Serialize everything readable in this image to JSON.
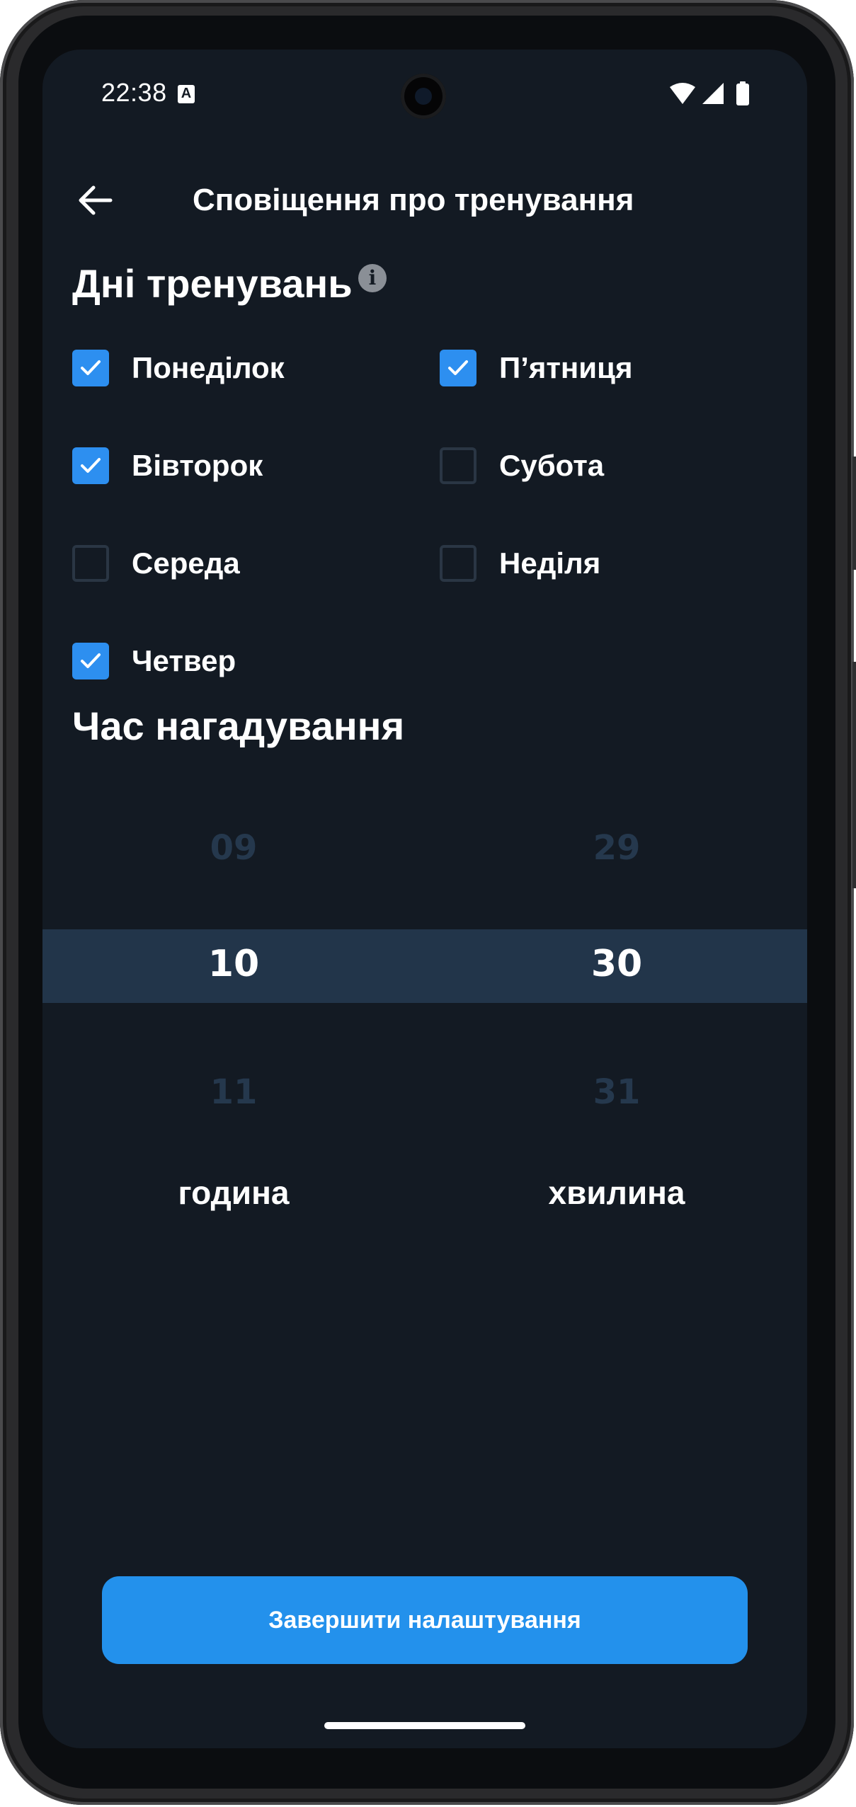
{
  "status_bar": {
    "time": "22:38",
    "notification_icon": "a-text-icon",
    "notification_letter": "A",
    "icons": [
      "wifi-icon",
      "signal-icon",
      "battery-icon"
    ]
  },
  "header": {
    "back_icon": "back-arrow-icon",
    "title": "Сповіщення про тренування"
  },
  "training_days": {
    "title": "Дні тренувань",
    "info_icon": "info-icon",
    "info_glyph": "i",
    "days": [
      {
        "label": "Понеділок",
        "checked": true
      },
      {
        "label": "Вівторок",
        "checked": true
      },
      {
        "label": "Середа",
        "checked": false
      },
      {
        "label": "Четвер",
        "checked": true
      },
      {
        "label": "П’ятниця",
        "checked": true
      },
      {
        "label": "Субота",
        "checked": false
      },
      {
        "label": "Неділя",
        "checked": false
      }
    ]
  },
  "reminder_time": {
    "title": "Час нагадування",
    "hour": {
      "prev": "09",
      "selected": "10",
      "next": "11",
      "unit": "година"
    },
    "minute": {
      "prev": "29",
      "selected": "30",
      "next": "31",
      "unit": "хвилина"
    }
  },
  "footer": {
    "finish_button": "Завершити налаштування"
  },
  "colors": {
    "background": "#131a23",
    "accent": "#2391ec",
    "checkbox_checked": "#2d8ff0",
    "picker_highlight": "#22354a"
  }
}
